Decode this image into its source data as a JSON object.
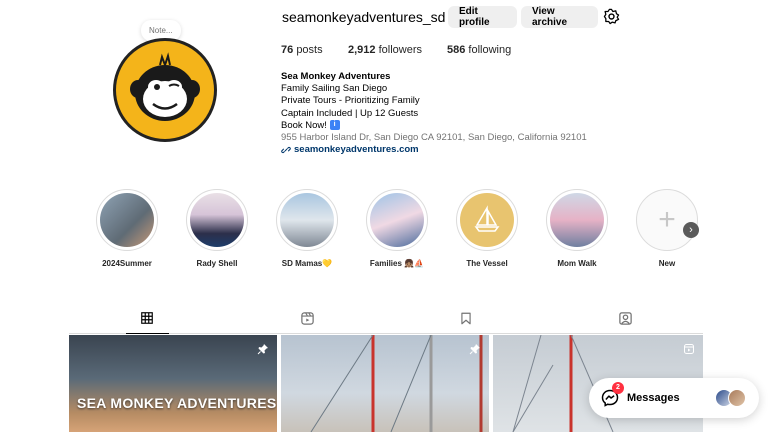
{
  "profile": {
    "username": "seamonkeyadventures_sd",
    "note": "Note...",
    "edit_label": "Edit profile",
    "archive_label": "View archive",
    "posts_count": "76",
    "posts_label": "posts",
    "followers_count": "2,912",
    "followers_label": "followers",
    "following_count": "586",
    "following_label": "following"
  },
  "bio": {
    "name": "Sea Monkey Adventures",
    "line1": "Family Sailing San Diego",
    "line2": "Private Tours - Prioritizing Family",
    "line3": "Captain Included | Up 12 Guests",
    "line4": "Book Now!",
    "line4_icon": "i",
    "address": "955 Harbor Island Dr, San Diego CA 92101, San Diego, California 92101",
    "link": "seamonkeyadventures.com"
  },
  "highlights": [
    {
      "label": "2024Summer"
    },
    {
      "label": "Rady Shell"
    },
    {
      "label": "SD Mamas💛"
    },
    {
      "label": "Families 👧🏽⛵"
    },
    {
      "label": "The Vessel"
    },
    {
      "label": "Mom Walk"
    },
    {
      "label": "New"
    }
  ],
  "tabs": [
    "posts-grid-icon",
    "reels-icon",
    "saved-icon",
    "tagged-icon"
  ],
  "posts": [
    {
      "overlay_text": "SEA MONKEY ADVENTURES",
      "pinned": true
    },
    {
      "overlay_text": "",
      "pinned": true
    },
    {
      "overlay_text": "",
      "reel": true
    }
  ],
  "messages": {
    "label": "Messages",
    "badge": "2"
  },
  "colors": {
    "accent": "#0095f6",
    "avatar_bg": "#f4b41a",
    "badge": "#ff3040",
    "link": "#00376b"
  }
}
